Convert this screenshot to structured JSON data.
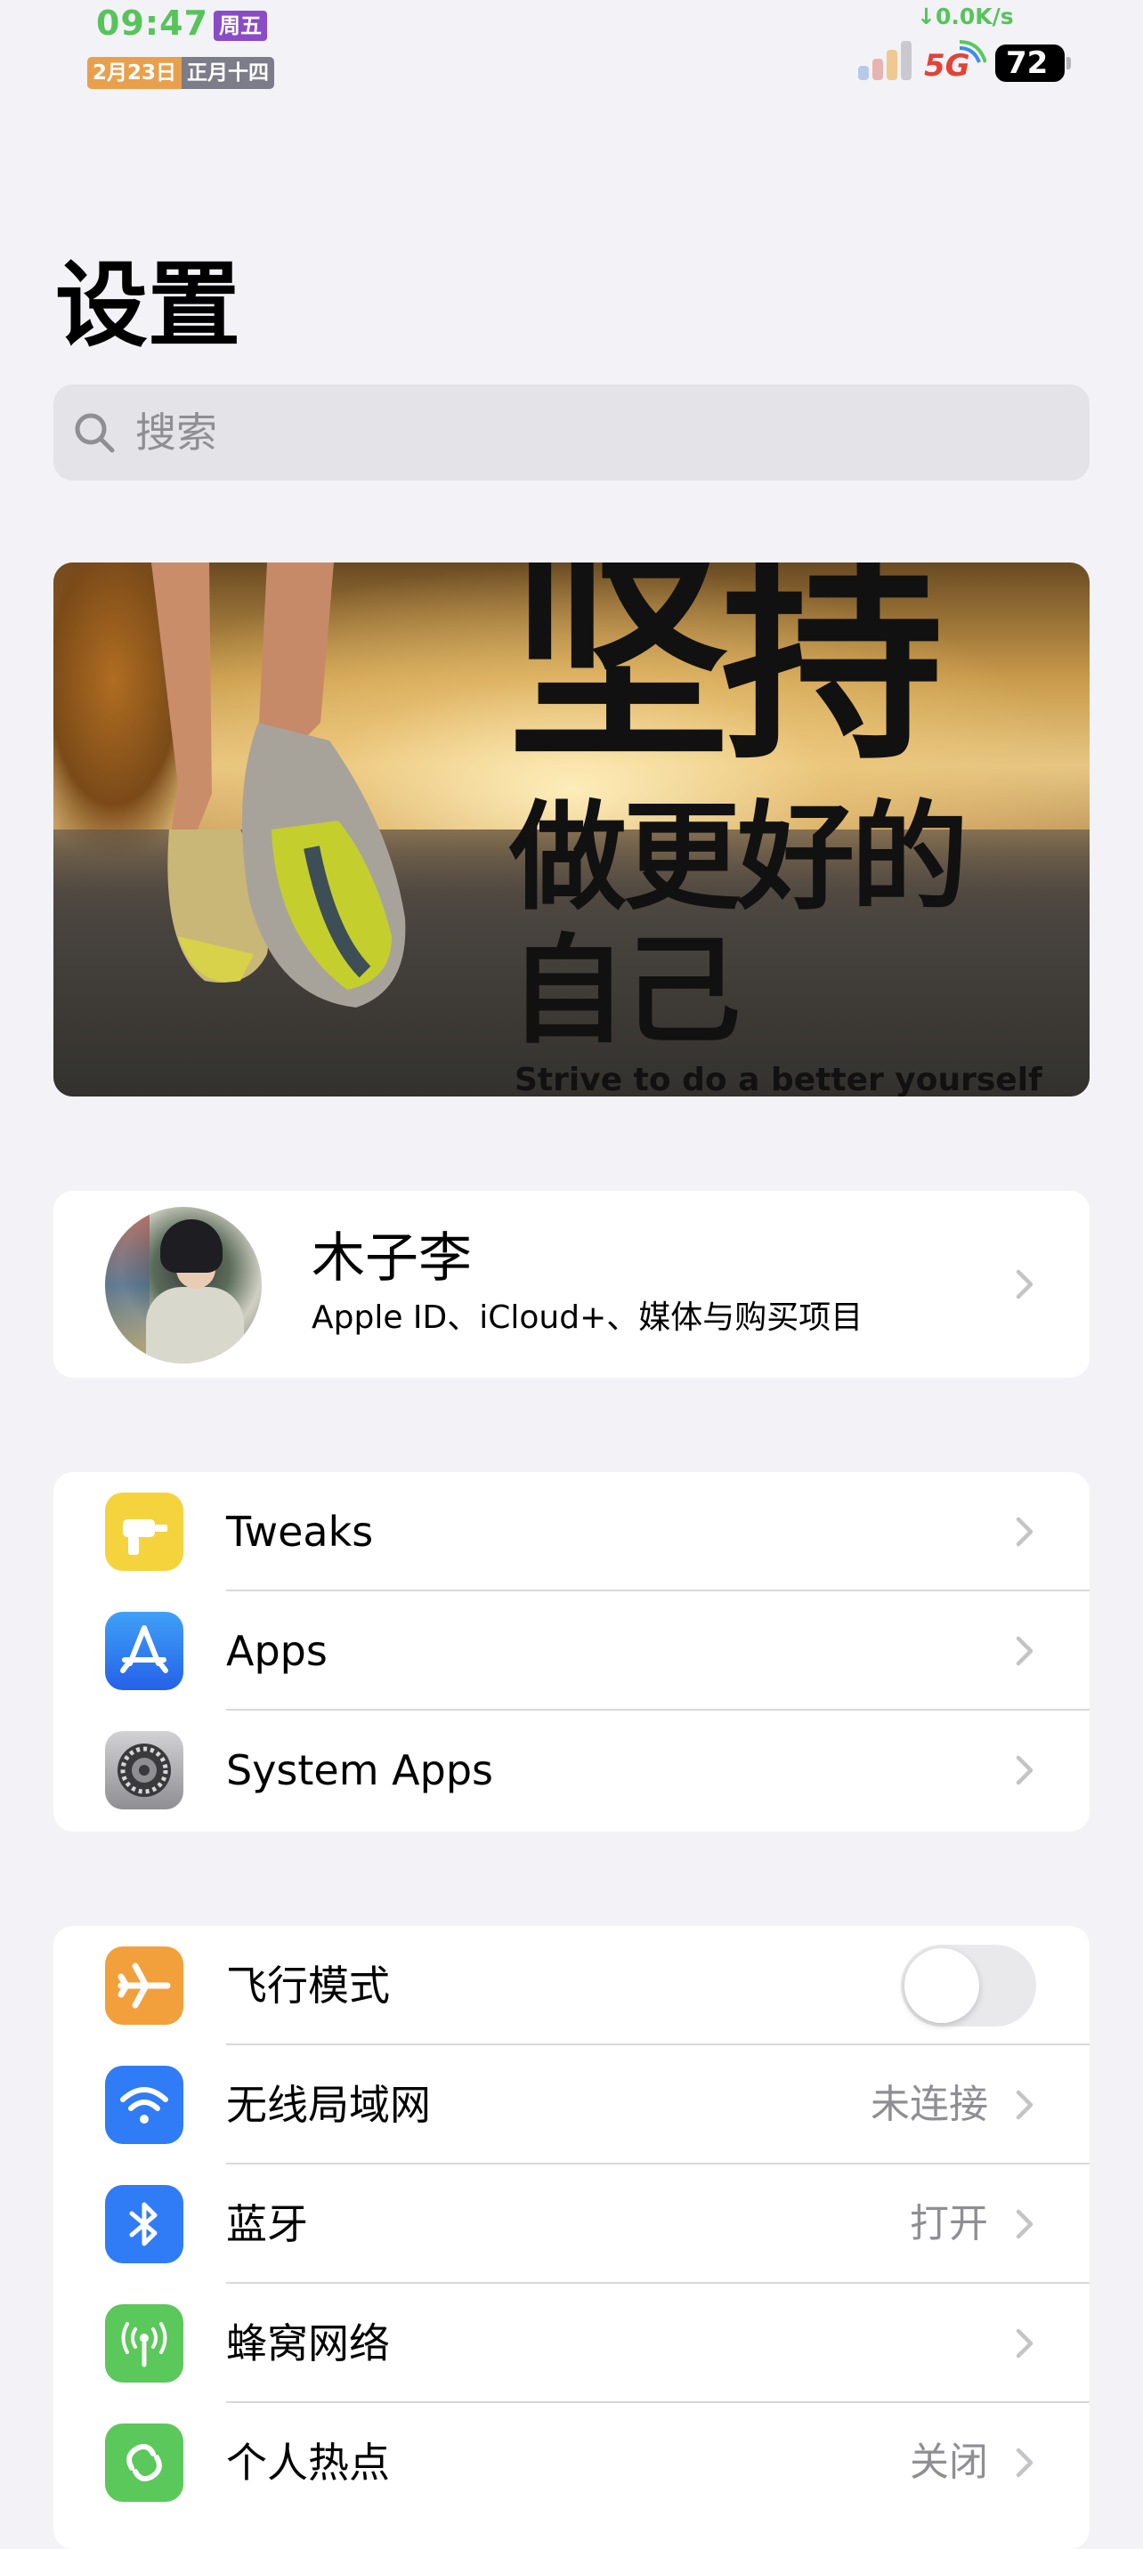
{
  "status_bar": {
    "time": "09:47",
    "weekday": "周五",
    "date": "2月23日",
    "lunar": "正月十四",
    "net_speed": "↓0.0K/s",
    "network": "5G",
    "battery": "72"
  },
  "page": {
    "title": "设置",
    "search_placeholder": "搜索"
  },
  "banner": {
    "slogan_line1": "坚持",
    "slogan_line2": "做更好的",
    "slogan_line3": "自己",
    "slogan_en": "Strive to do a better yourself"
  },
  "profile": {
    "name": "木子李",
    "subtitle": "Apple ID、iCloud+、媒体与购买项目"
  },
  "apps_group": [
    {
      "label": "Tweaks",
      "icon": "drill-icon",
      "color": "#f5d33d"
    },
    {
      "label": "Apps",
      "icon": "app-store-icon",
      "color": "#2f7cf6"
    },
    {
      "label": "System Apps",
      "icon": "gear-icon",
      "color": "#8e8e93"
    }
  ],
  "network_group": [
    {
      "label": "飞行模式",
      "icon": "airplane-icon",
      "color": "#f2a03b",
      "toggle": false
    },
    {
      "label": "无线局域网",
      "icon": "wifi-icon",
      "color": "#2f7cf6",
      "value": "未连接"
    },
    {
      "label": "蓝牙",
      "icon": "bluetooth-icon",
      "color": "#2f7cf6",
      "value": "打开"
    },
    {
      "label": "蜂窝网络",
      "icon": "cellular-icon",
      "color": "#5ac85a",
      "value": ""
    },
    {
      "label": "个人热点",
      "icon": "hotspot-icon",
      "color": "#5ac85a",
      "value": "关闭"
    }
  ]
}
